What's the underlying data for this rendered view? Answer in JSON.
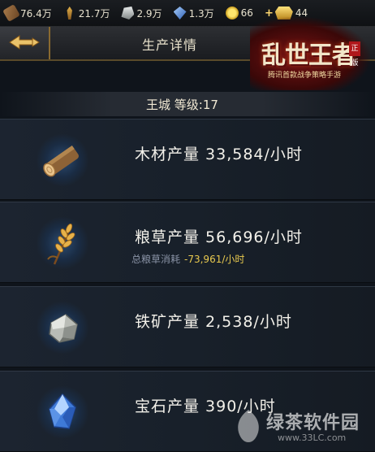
{
  "resources": [
    {
      "icon": "wood-icon",
      "value": "76.4万"
    },
    {
      "icon": "grain-icon",
      "value": "21.7万"
    },
    {
      "icon": "iron-icon",
      "value": "2.9万"
    },
    {
      "icon": "gem-icon",
      "value": "1.3万"
    },
    {
      "icon": "coin-icon",
      "value": "66"
    },
    {
      "icon": "gold-ingot-icon",
      "value": "44"
    }
  ],
  "header": {
    "title": "生产详情"
  },
  "logo": {
    "title": "乱世王者",
    "subtitle": "腾讯首款战争策略手游",
    "seal": "正版"
  },
  "city": {
    "text": "王城  等级:17"
  },
  "rows": [
    {
      "label": "木材产量  33,584/小时"
    },
    {
      "label": "粮草产量  56,696/小时",
      "sub_label": "总粮草消耗",
      "sub_value": "-73,961/小时"
    },
    {
      "label": "铁矿产量  2,538/小时"
    },
    {
      "label": "宝石产量  390/小时"
    }
  ],
  "watermark": {
    "text": "绿茶软件园",
    "url": "www.33LC.com"
  }
}
